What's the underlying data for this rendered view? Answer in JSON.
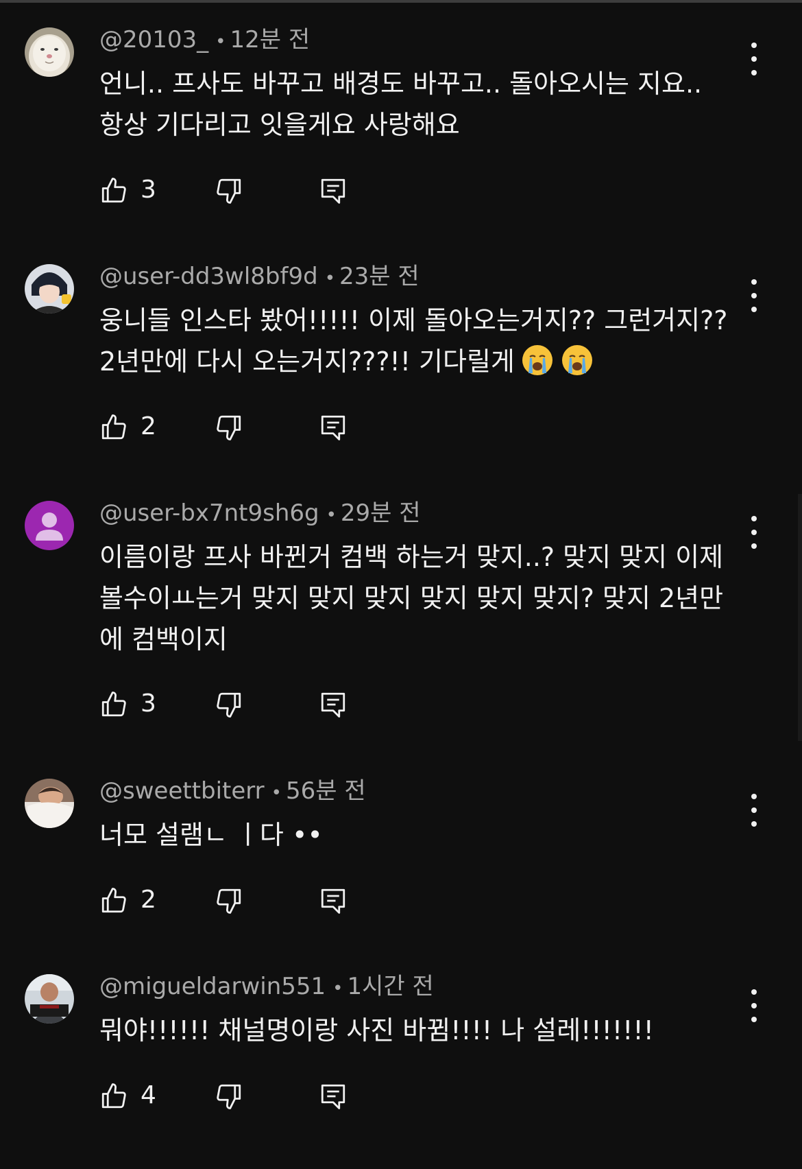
{
  "comments": [
    {
      "author": "@20103_",
      "time": "12분 전",
      "text_lines": [
        "언니.. 프사도 바꾸고 배경도 바꾸고.. 돌아오시는 지요..",
        "항상 기다리고 잇을게요 사랑해요"
      ],
      "likes": "3",
      "avatar": "cat-face-avatar"
    },
    {
      "author": "@user-dd3wl8bf9d",
      "time": "23분 전",
      "text_lines": [
        "웅니들 인스타 봤어!!!!! 이제 돌아오는거지?? 그런거지??",
        "2년만에 다시 오는거지???!! 기다릴게"
      ],
      "emoji": [
        "crying-face-emoji",
        "crying-face-emoji"
      ],
      "likes": "2",
      "avatar": "person-photo-avatar"
    },
    {
      "author": "@user-bx7nt9sh6g",
      "time": "29분 전",
      "text_lines": [
        "이름이랑 프사 바뀐거 컴백 하는거 맞지..? 맞지 맞지 이제",
        "볼수이ㅛ는거 맞지 맞지 맞지 맞지 맞지 맞지? 맞지 2년만",
        "에 컴백이지"
      ],
      "likes": "3",
      "avatar": "default-purple-avatar",
      "avatar_color": "#9c27b0"
    },
    {
      "author": "@sweettbiterr",
      "time": "56분 전",
      "text_lines": [
        "너모 설램ㄴ ㅣ다 ••"
      ],
      "likes": "2",
      "avatar": "sleeping-person-avatar"
    },
    {
      "author": "@migueldarwin551",
      "time": "1시간 전",
      "text_lines": [
        "뭐야!!!!!! 채널명이랑 사진 바뀜!!!! 나 설레!!!!!!!"
      ],
      "likes": "4",
      "avatar": "man-photo-avatar"
    }
  ],
  "colors": {
    "background": "#0f0f0f",
    "text_primary": "#f1f1f1",
    "text_secondary": "#aaaaaa"
  },
  "icons": {
    "like": "thumbs-up-icon",
    "dislike": "thumbs-down-icon",
    "reply": "reply-comment-icon",
    "menu": "more-vert-icon"
  }
}
